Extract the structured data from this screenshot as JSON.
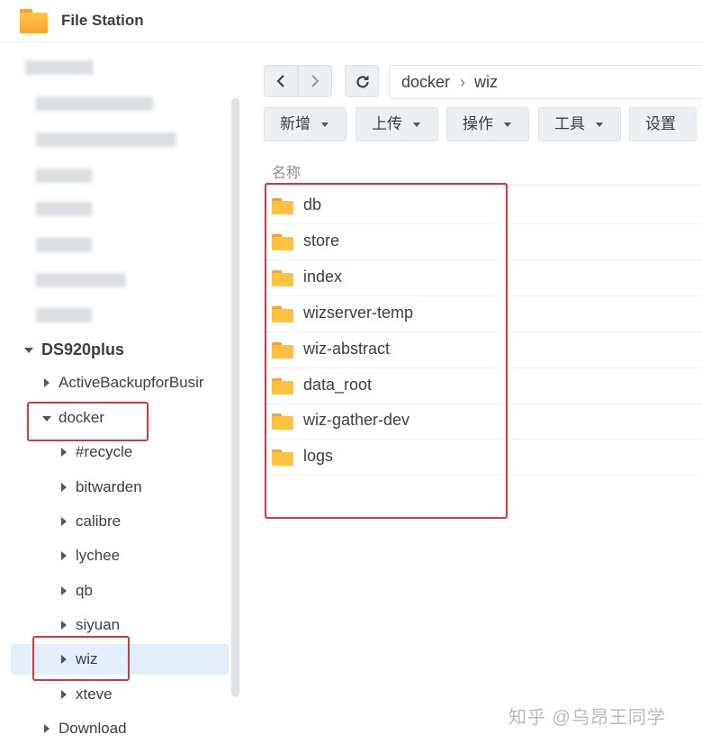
{
  "app": {
    "title": "File Station"
  },
  "sidebar": {
    "root_label": "DS920plus",
    "nodes": [
      {
        "label": "ActiveBackupforBusir"
      },
      {
        "label": "docker"
      },
      {
        "label": "#recycle"
      },
      {
        "label": "bitwarden"
      },
      {
        "label": "calibre"
      },
      {
        "label": "lychee"
      },
      {
        "label": "qb"
      },
      {
        "label": "siyuan"
      },
      {
        "label": "wiz"
      },
      {
        "label": "xteve"
      },
      {
        "label": "Download"
      }
    ]
  },
  "nav": {
    "path": [
      "docker",
      "wiz"
    ]
  },
  "toolbar": {
    "add_label": "新增",
    "upload_label": "上传",
    "action_label": "操作",
    "tools_label": "工具",
    "settings_label": "设置"
  },
  "file_list": {
    "column_name": "名称",
    "rows": [
      {
        "name": "db"
      },
      {
        "name": "store"
      },
      {
        "name": "index"
      },
      {
        "name": "wizserver-temp"
      },
      {
        "name": "wiz-abstract"
      },
      {
        "name": "data_root"
      },
      {
        "name": "wiz-gather-dev"
      },
      {
        "name": "logs"
      }
    ]
  },
  "watermark": "知乎 @乌昂王同学",
  "colors": {
    "highlight_box": "#d9363e",
    "selected_bg": "#e3eefb",
    "folder": "#ffc23f"
  }
}
